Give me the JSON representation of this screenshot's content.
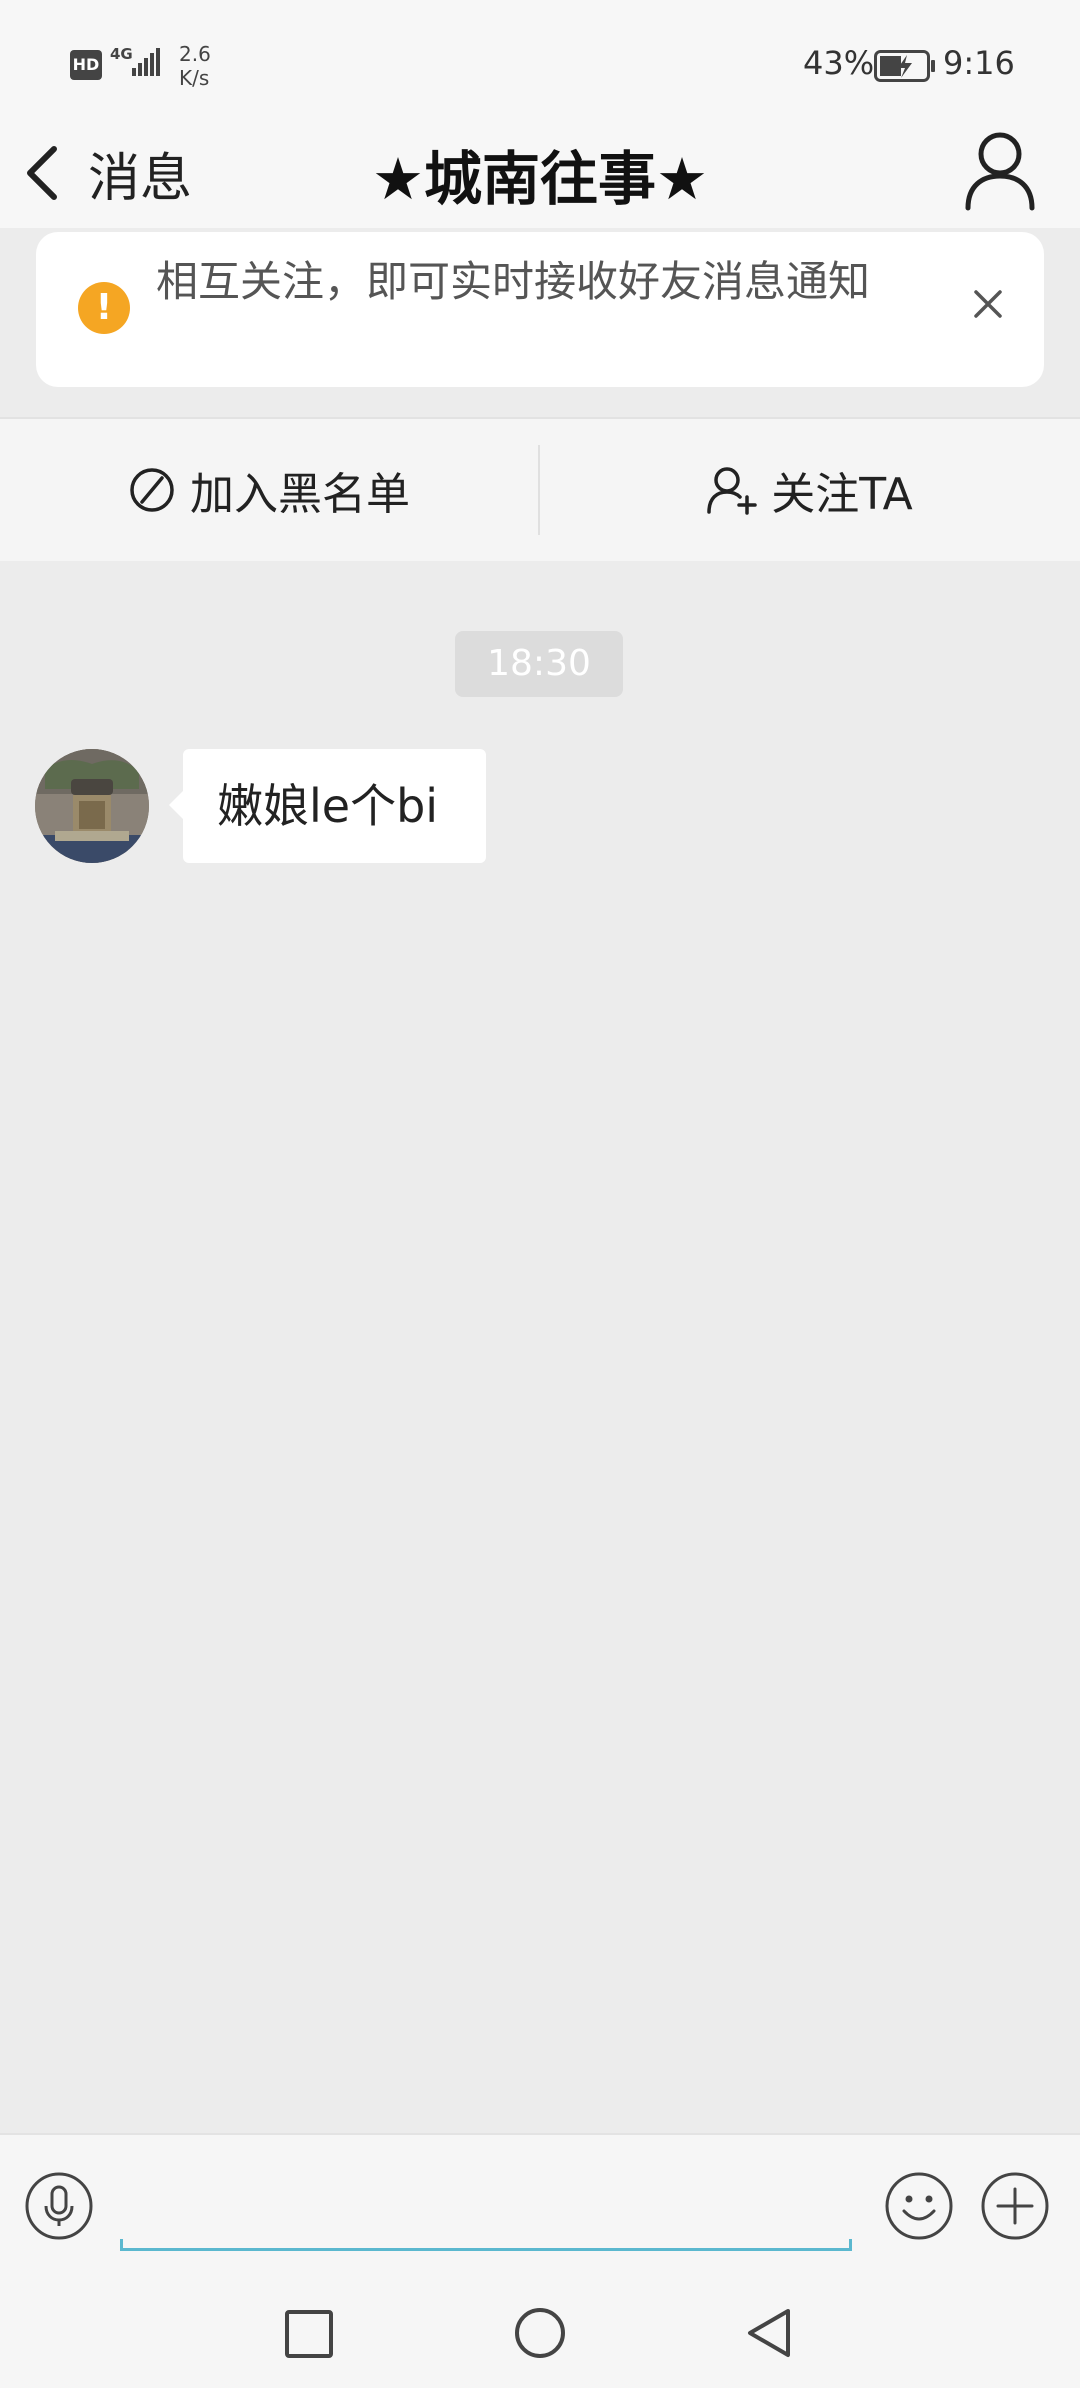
{
  "status_bar": {
    "hd": "HD",
    "net_type": "4G",
    "speed_value": "2.6",
    "speed_unit": "K/s",
    "battery": "43%",
    "time": "9:16"
  },
  "header": {
    "back_label": "消息",
    "title": "★城南往事★"
  },
  "notice": {
    "icon": "!",
    "text": "相互关注，即可实时接收好友消息通知"
  },
  "actions": {
    "blacklist_label": "加入黑名单",
    "follow_label": "关注TA"
  },
  "chat": {
    "timestamp": "18:30",
    "messages": [
      {
        "text": "嫩娘le个bi"
      }
    ]
  },
  "input": {
    "placeholder": ""
  },
  "colors": {
    "accent_orange": "#f5a623",
    "input_underline": "#5bb8cf",
    "chat_background": "#ececec"
  },
  "icons": {
    "back": "chevron-left-icon",
    "profile": "person-icon",
    "notice": "exclamation-icon",
    "close": "close-icon",
    "blacklist": "block-icon",
    "follow": "add-person-icon",
    "voice": "microphone-icon",
    "emoji": "smiley-icon",
    "more": "plus-icon"
  }
}
